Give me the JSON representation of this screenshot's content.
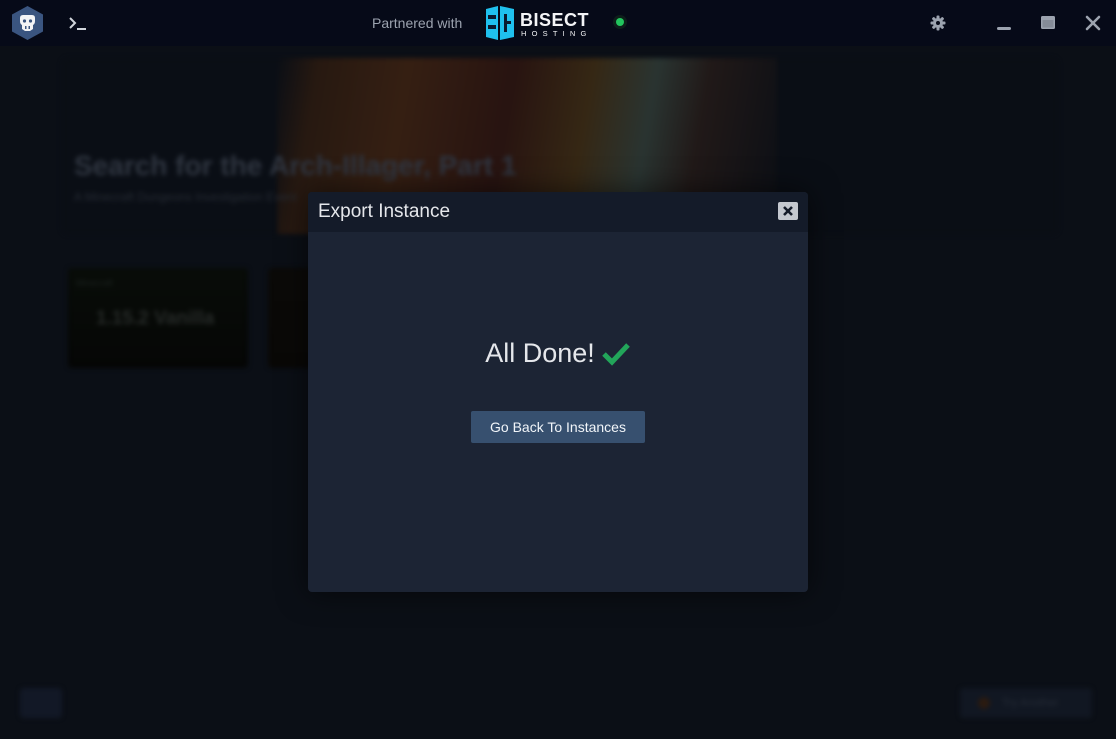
{
  "titlebar": {
    "partner_text": "Partnered with",
    "partner_brand": "BISECT",
    "partner_brand_sub": "HOSTING",
    "status_color": "#22c55e",
    "icons": [
      "app-logo-icon",
      "terminal-icon",
      "gear-icon",
      "minimize-icon",
      "maximize-icon",
      "close-icon"
    ]
  },
  "background": {
    "hero_title": "Search for the Arch-Illager, Part 1",
    "hero_subtitle": "A Minecraft Dungeons Investigation Event",
    "cards": [
      {
        "tag": "Minecraft",
        "title": "1.15.2 Vanilla"
      },
      {
        "tag": "",
        "title": ""
      }
    ],
    "bottom_right_label": "Try Another"
  },
  "modal": {
    "title": "Export Instance",
    "message": "All Done!",
    "check_color": "#22c55e",
    "button_label": "Go Back To Instances"
  }
}
